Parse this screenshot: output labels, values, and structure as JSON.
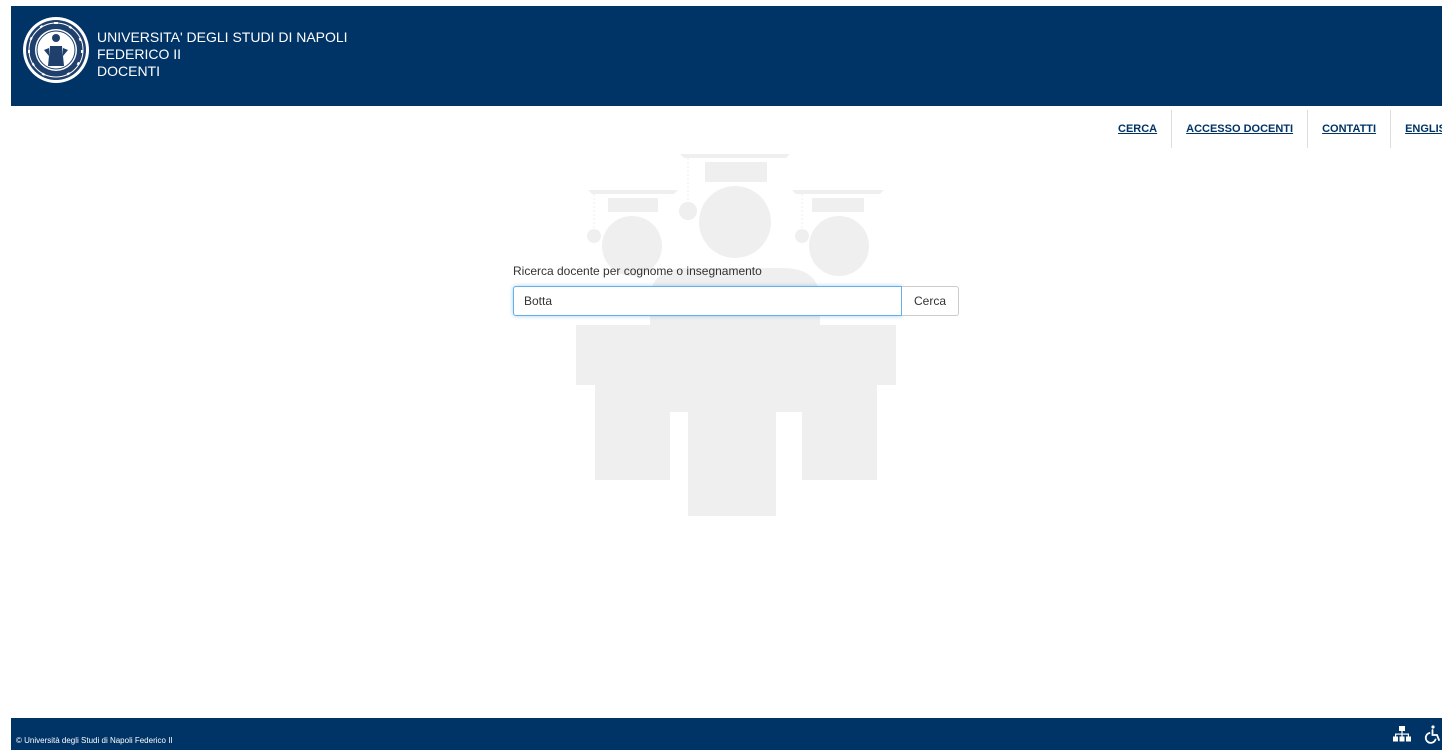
{
  "header": {
    "line1": "UNIVERSITA' DEGLI STUDI DI NAPOLI",
    "line2": "FEDERICO II",
    "line3": "DOCENTI",
    "seal_icon": "university-seal-icon"
  },
  "nav": {
    "items": [
      {
        "label": "CERCA"
      },
      {
        "label": "ACCESSO DOCENTI"
      },
      {
        "label": "CONTATTI"
      },
      {
        "label": "ENGLISH"
      }
    ]
  },
  "search": {
    "label": "Ricerca docente per cognome o insegnamento",
    "value": "Botta",
    "button_label": "Cerca"
  },
  "footer": {
    "copyright": "© Università degli Studi di Napoli Federico II",
    "icons": [
      "sitemap-icon",
      "accessibility-icon"
    ]
  },
  "colors": {
    "primary": "#003366",
    "focus": "#66afe9",
    "illustration": "#efefef"
  }
}
